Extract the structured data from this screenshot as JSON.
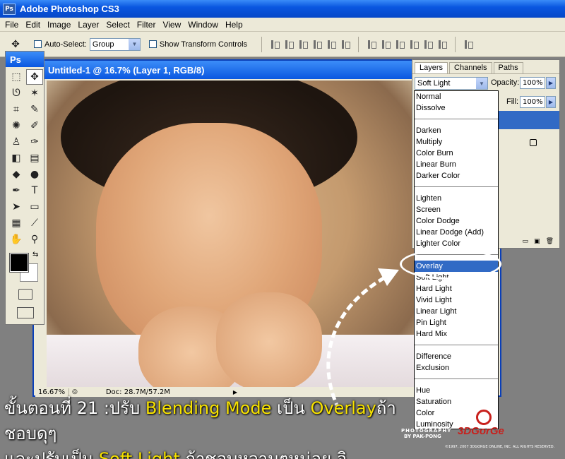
{
  "app": {
    "title": "Adobe Photoshop CS3",
    "logo": "Ps"
  },
  "menu": [
    "File",
    "Edit",
    "Image",
    "Layer",
    "Select",
    "Filter",
    "View",
    "Window",
    "Help"
  ],
  "options": {
    "auto_select_label": "Auto-Select:",
    "auto_select_value": "Group",
    "show_transform_label": "Show Transform Controls"
  },
  "toolbox": {
    "logo": "Ps"
  },
  "document": {
    "title": "Untitled-1 @ 16.7% (Layer 1, RGB/8)",
    "zoom": "16.67%",
    "doc_info": "Doc: 28.7M/57.2M"
  },
  "layers_panel": {
    "tabs": [
      "Layers",
      "Channels",
      "Paths"
    ],
    "blend_mode": "Soft Light",
    "opacity_label": "Opacity:",
    "opacity_value": "100%",
    "fill_label": "Fill:",
    "fill_value": "100%"
  },
  "blend_modes": [
    [
      "Normal",
      "Dissolve"
    ],
    [
      "Darken",
      "Multiply",
      "Color Burn",
      "Linear Burn",
      "Darker Color"
    ],
    [
      "Lighten",
      "Screen",
      "Color Dodge",
      "Linear Dodge (Add)",
      "Lighter Color"
    ],
    [
      "Overlay",
      "Soft Light",
      "Hard Light",
      "Vivid Light",
      "Linear Light",
      "Pin Light",
      "Hard Mix"
    ],
    [
      "Difference",
      "Exclusion"
    ],
    [
      "Hue",
      "Saturation",
      "Color",
      "Luminosity"
    ]
  ],
  "selected_blend": "Overlay",
  "caption": {
    "line1_a": "ขั้นตอนที่ 21 :ปรับ ",
    "line1_hl1": "Blending Mode",
    "line1_b": " เป็น ",
    "line1_hl2": "Overlay",
    "line1_c": "ถ้าชอบดุๆ",
    "line2_a": "และปรับเป็น ",
    "line2_hl": "Soft Light",
    "line2_b": " ถ้าชอบหวานๆหน่อย อิ.."
  },
  "watermark": {
    "credit1": "PHOTOGRAPHY",
    "credit2": "BY PAK-PONG",
    "brand": "3DGorGe",
    "copyright": "©1997, 2007 3DGORGE ONLINE, INC. ALL RIGHTS RESERVED."
  },
  "colors": {
    "accent": "#316ac5",
    "titlebar": "#0a57e0",
    "highlight_text": "#f7e200"
  }
}
